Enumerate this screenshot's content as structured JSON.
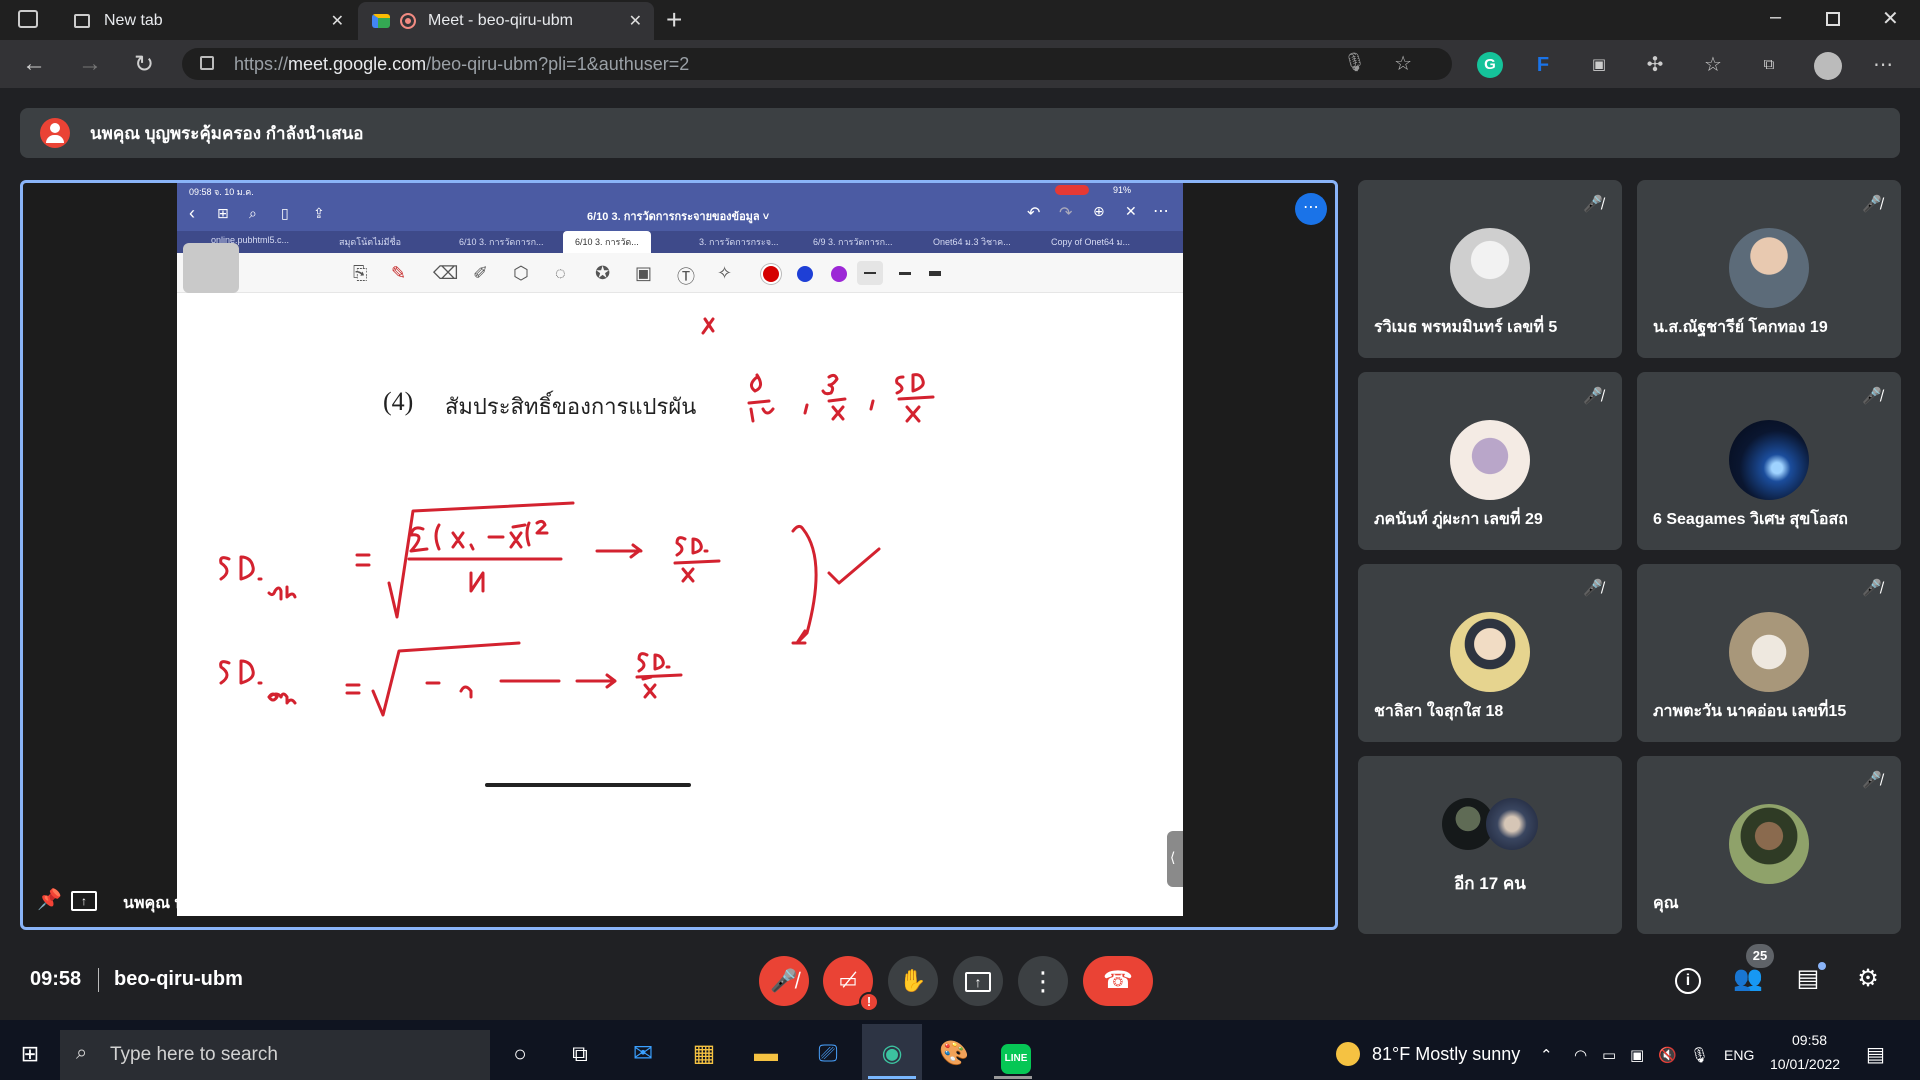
{
  "browser": {
    "tabs": [
      {
        "label": "New tab",
        "active": false
      },
      {
        "label": "Meet - beo-qiru-ubm",
        "active": true
      }
    ],
    "url_prefix": "https://",
    "url_domain": "meet.google.com",
    "url_path": "/beo-qiru-ubm?pli=1&authuser=2"
  },
  "banner": {
    "presenter_text": "นพคุณ บุญพระคุ้มครอง กำลังนำเสนอ"
  },
  "ipad": {
    "status_time": "09:58  จ. 10 ม.ค.",
    "status_right": "91%",
    "doc_title": "6/10 3. การวัดการกระจายของข้อมูล ˅",
    "tabs": [
      "online.pubhtml5.c...",
      "สมุดโน้ตไม่มีชื่อ",
      "6/10 3. การวัดการก...",
      "6/10 3. การวัด...",
      "3. การวัดการกระจ...",
      "6/9 3. การวัดการก...",
      "Onet64 ม.3 วิชาค...",
      "Copy of Onet64 ม..."
    ],
    "heading_num": "(4)",
    "heading_text": "สัมประสิทธิ์ของการแปรผัน"
  },
  "presenter_label": "นพคุณ บุญพระคุ้มครอง",
  "participants": [
    {
      "name": "รวิเมธ พรหมมินทร์ เลขที่ 5",
      "muted": true,
      "avatar_color": "#d9d9d9"
    },
    {
      "name": "น.ส.ณัฐชารีย์ โคกทอง 19",
      "muted": true,
      "avatar_color": "#8fa3b8"
    },
    {
      "name": "ภคนันท์ ภู่ผะกา เลขที่ 29",
      "muted": true,
      "avatar_color": "#efe3da"
    },
    {
      "name": "6 Seagames วิเศษ สุขโอสถ",
      "muted": true,
      "avatar_color": "#0a1630"
    },
    {
      "name": "ชาลิสา ใจสุกใส 18",
      "muted": true,
      "avatar_color": "#d8c98a"
    },
    {
      "name": "ภาพตะวัน นาคอ่อน เลขที่15",
      "muted": true,
      "avatar_color": "#a8977a"
    },
    {
      "name": "อีก 17 คน",
      "muted": false,
      "avatar_color": "#333"
    },
    {
      "name": "คุณ",
      "muted": true,
      "avatar_color": "#6f7f5a"
    }
  ],
  "meeting": {
    "time": "09:58",
    "code": "beo-qiru-ubm",
    "people_count": "25"
  },
  "taskbar": {
    "search_placeholder": "Type here to search",
    "weather": "81°F  Mostly sunny",
    "lang": "ENG",
    "time": "09:58",
    "date": "10/01/2022"
  },
  "colors": {
    "accent": "#8ab4f8",
    "hangup": "#ea4335",
    "ink": "#d3222f"
  }
}
